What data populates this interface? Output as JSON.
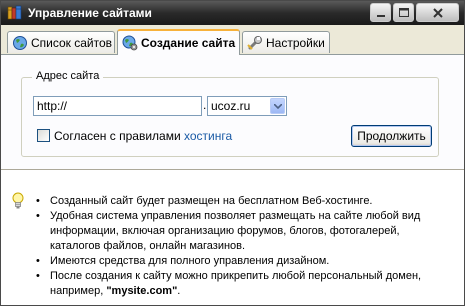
{
  "window": {
    "title": "Управление сайтами",
    "app_icon": "books-icon"
  },
  "tabs": [
    {
      "label": "Список сайтов",
      "icon": "globe-icon",
      "active": false
    },
    {
      "label": "Создание сайта",
      "icon": "globe-gear-icon",
      "active": true
    },
    {
      "label": "Настройки",
      "icon": "wrench-icon",
      "active": false
    }
  ],
  "form": {
    "group_label": "Адрес сайта",
    "url_value": "http://",
    "separator": ".",
    "domain_selected": "ucoz.ru",
    "agree_label": "Согласен с правилами",
    "agree_link": "хостинга",
    "agree_checked": false,
    "continue_label": "Продолжить"
  },
  "info": {
    "icon": "lightbulb-icon",
    "bullet": "•",
    "items": [
      "Созданный сайт будет размещен на бесплатном Веб-хостинге.",
      "Удобная система управления позволяет размещать на сайте любой вид информации, включая организацию форумов, блогов, фотогалерей, каталогов файлов, онлайн магазинов.",
      "Имеются средства для полного управления дизайном.",
      "После создания к сайту можно прикрепить любой персональный домен, например, "
    ],
    "example_domain": "\"mysite.com\"",
    "example_suffix": "."
  }
}
